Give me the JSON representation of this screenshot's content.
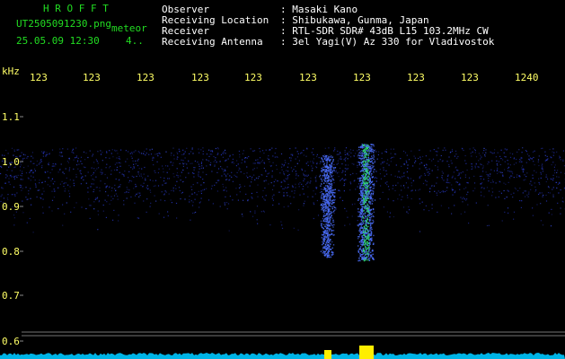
{
  "header": {
    "app_title": "H R O F F T",
    "filename": "UT2505091230.png",
    "type_label": "meteor",
    "datetime": "25.05.09 12:30",
    "count": "4.."
  },
  "station": {
    "rows": [
      {
        "label": "Observer",
        "value": ": Masaki Kano"
      },
      {
        "label": "Receiving Location",
        "value": ": Shibukawa, Gunma, Japan"
      },
      {
        "label": "Receiver",
        "value": ": RTL-SDR SDR# 43dB L15 103.2MHz CW"
      },
      {
        "label": "Receiving Antenna",
        "value": ": 3el Yagi(V) Az 330 for Vladivostok"
      }
    ]
  },
  "axes": {
    "y_unit": "kHz",
    "y_ticks": [
      "1.1",
      "1.0",
      "0.9",
      "0.8",
      "0.7",
      "0.6"
    ],
    "time_ticks": [
      "123",
      "123",
      "123",
      "123",
      "123",
      "123",
      "123",
      "123",
      "123",
      "1240"
    ]
  },
  "colors": {
    "background": "#000000",
    "label_text": "#ffffff",
    "title_green": "#22dd22",
    "tick_yellow": "#ffff66",
    "signal_blue": "#2838c8",
    "signal_green": "#30e070",
    "level_cyan": "#00c8ff",
    "level_peak": "#ffee00"
  }
}
